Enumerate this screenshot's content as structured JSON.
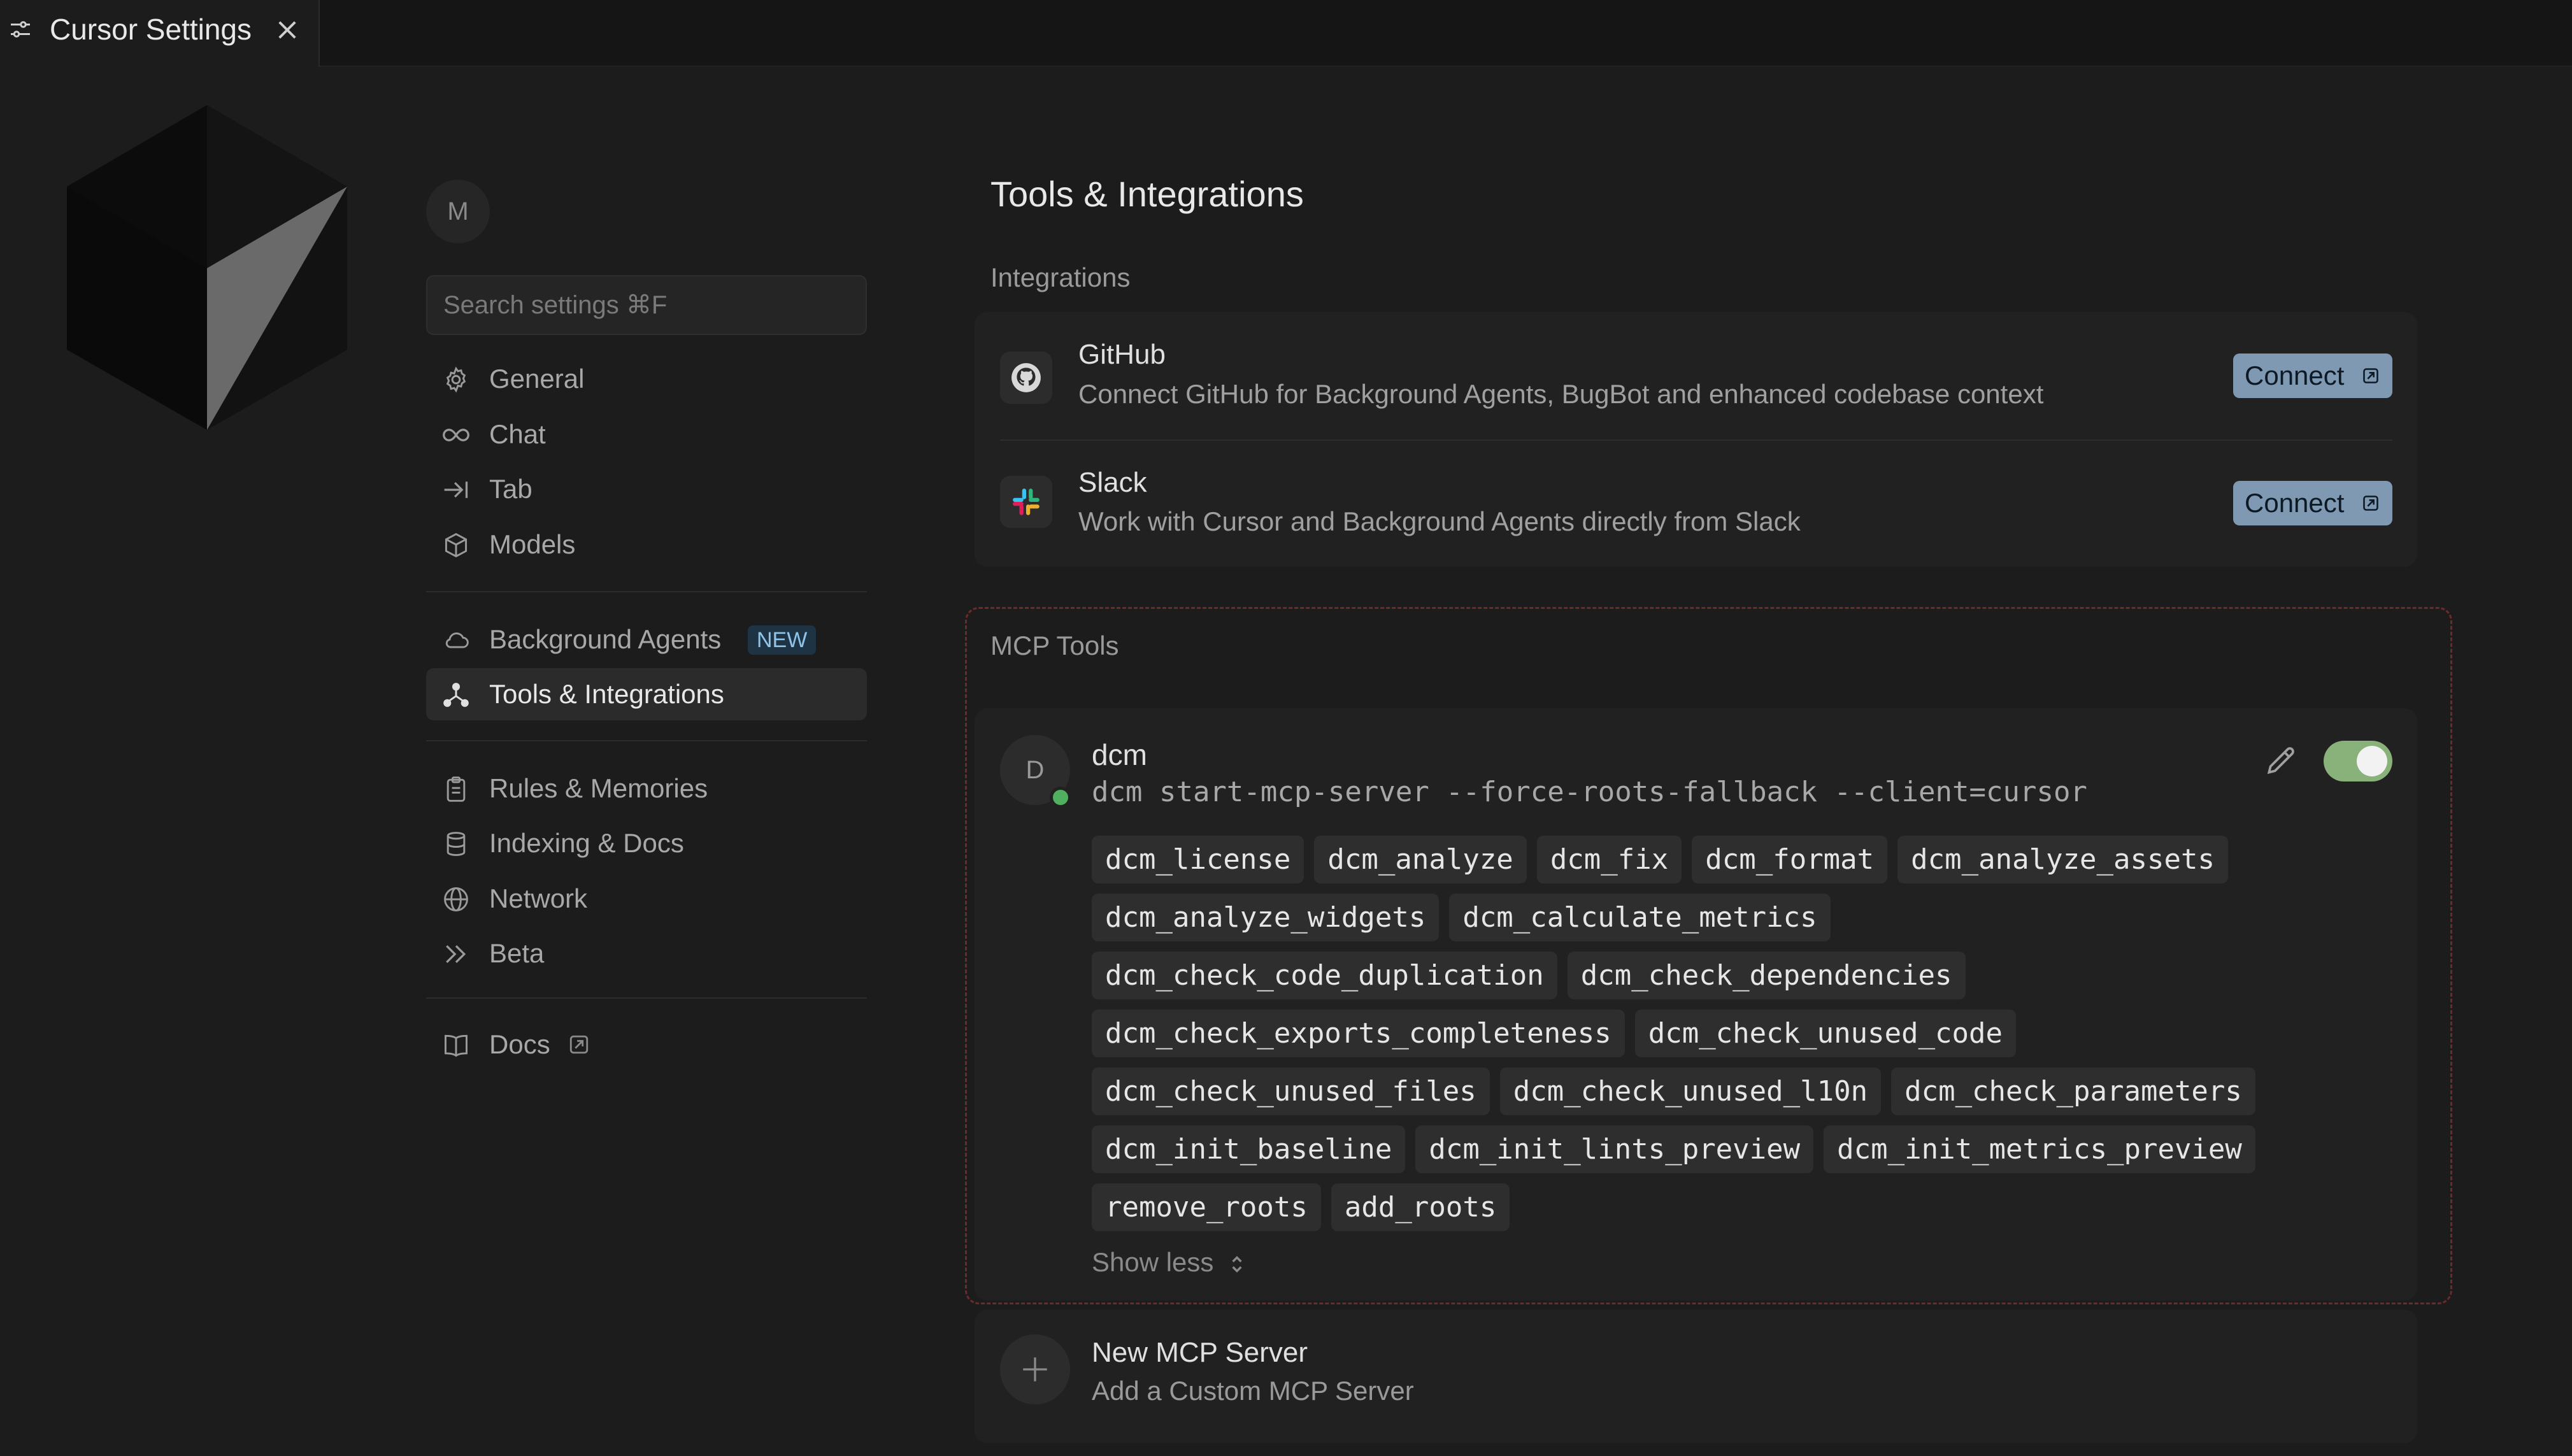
{
  "tab": {
    "title": "Cursor Settings"
  },
  "sidebar": {
    "avatar_initial": "M",
    "search_placeholder": "Search settings ⌘F",
    "items": [
      {
        "label": "General",
        "icon": "gear-icon"
      },
      {
        "label": "Chat",
        "icon": "infinity-icon"
      },
      {
        "label": "Tab",
        "icon": "arrow-right-to-bar-icon"
      },
      {
        "label": "Models",
        "icon": "cube-icon"
      },
      {
        "label": "Background Agents",
        "icon": "cloud-icon",
        "badge": "NEW"
      },
      {
        "label": "Tools & Integrations",
        "icon": "tools-network-icon",
        "active": true
      },
      {
        "label": "Rules & Memories",
        "icon": "clipboard-icon"
      },
      {
        "label": "Indexing & Docs",
        "icon": "database-icon"
      },
      {
        "label": "Network",
        "icon": "globe-icon"
      },
      {
        "label": "Beta",
        "icon": "double-chevron-right-icon"
      },
      {
        "label": "Docs",
        "icon": "book-icon"
      }
    ]
  },
  "main": {
    "title": "Tools & Integrations",
    "integrations": {
      "label": "Integrations",
      "items": [
        {
          "name": "GitHub",
          "description": "Connect GitHub for Background Agents, BugBot and enhanced codebase context",
          "button": "Connect"
        },
        {
          "name": "Slack",
          "description": "Work with Cursor and Background Agents directly from Slack",
          "button": "Connect"
        }
      ]
    },
    "mcp": {
      "label": "MCP Tools",
      "server": {
        "initial": "D",
        "name": "dcm",
        "command": "dcm start-mcp-server --force-roots-fallback --client=cursor",
        "enabled": true,
        "tool_rows": [
          [
            "dcm_license",
            "dcm_analyze",
            "dcm_fix",
            "dcm_format",
            "dcm_analyze_assets"
          ],
          [
            "dcm_analyze_widgets",
            "dcm_calculate_metrics"
          ],
          [
            "dcm_check_code_duplication",
            "dcm_check_dependencies"
          ],
          [
            "dcm_check_exports_completeness",
            "dcm_check_unused_code"
          ],
          [
            "dcm_check_unused_files",
            "dcm_check_unused_l10n",
            "dcm_check_parameters"
          ],
          [
            "dcm_init_baseline",
            "dcm_init_lints_preview",
            "dcm_init_metrics_preview"
          ],
          [
            "remove_roots",
            "add_roots"
          ]
        ],
        "show_less": "Show less"
      },
      "new_server": {
        "title": "New MCP Server",
        "subtitle": "Add a Custom MCP Server"
      }
    }
  },
  "colors": {
    "background": "#1c1c1c",
    "connect_button": "#7e99b1",
    "toggle_on": "#89b17a",
    "status_online": "#50b060",
    "new_badge": "#1e3445"
  }
}
